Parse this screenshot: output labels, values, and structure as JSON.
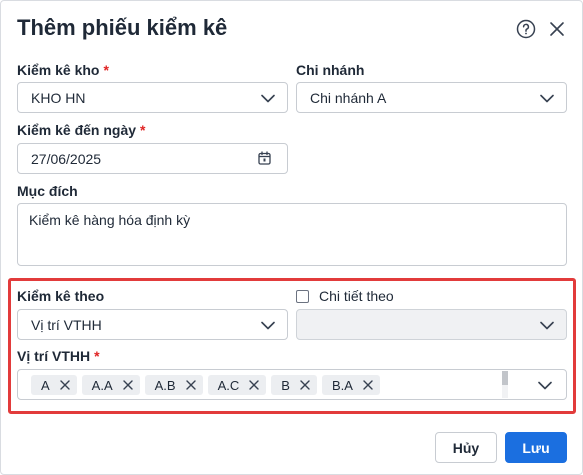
{
  "dialog": {
    "title": "Thêm phiếu kiểm kê"
  },
  "form": {
    "warehouse": {
      "label": "Kiểm kê kho",
      "required": "*",
      "value": "KHO HN"
    },
    "branch": {
      "label": "Chi nhánh",
      "value": "Chi nhánh A"
    },
    "to_date": {
      "label": "Kiểm kê đến ngày",
      "required": "*",
      "value": "27/06/2025"
    },
    "purpose": {
      "label": "Mục đích",
      "value": "Kiểm kê hàng hóa định kỳ"
    },
    "count_by": {
      "label": "Kiểm kê theo",
      "value": "Vị trí VTHH"
    },
    "detail_by": {
      "label": "Chi tiết theo",
      "checked": false,
      "value": ""
    },
    "locations": {
      "label": "Vị trí VTHH",
      "required": "*",
      "tags": [
        "A",
        "A.A",
        "A.B",
        "A.C",
        "B",
        "B.A"
      ]
    }
  },
  "footer": {
    "cancel_label": "Hủy",
    "save_label": "Lưu"
  },
  "colors": {
    "primary": "#1b6fe0",
    "required": "#e02424",
    "highlight": "#e23b3b"
  },
  "icons": {
    "help": "help-icon",
    "close": "close-icon",
    "dropdown": "chevron-down-icon",
    "calendar": "calendar-icon",
    "remove_tag": "close-icon"
  }
}
